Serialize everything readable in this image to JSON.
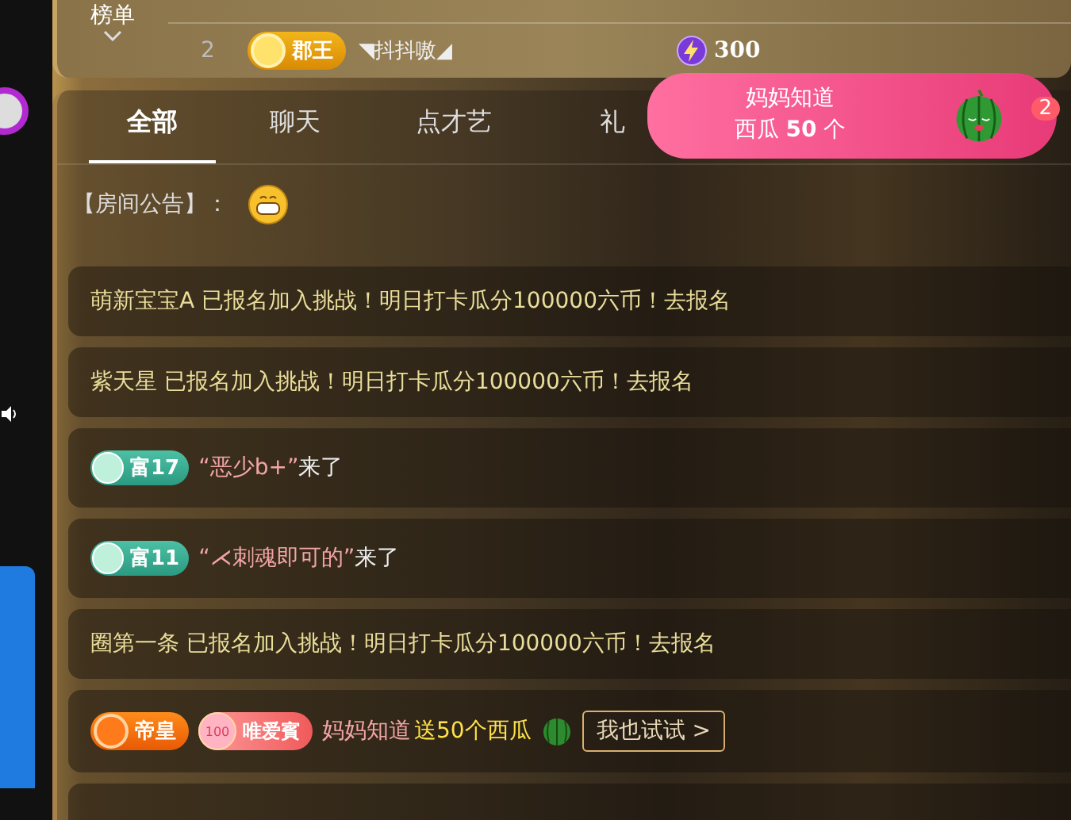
{
  "leaderboard": {
    "label": "榜单",
    "rows": [
      {
        "rank": "2",
        "badge": "郡王",
        "name": "◥抖抖嗷◢",
        "score": "300"
      }
    ]
  },
  "tabs": [
    {
      "label": "全部",
      "selected": true
    },
    {
      "label": "聊天",
      "selected": false
    },
    {
      "label": "点才艺",
      "selected": false
    },
    {
      "label": "礼",
      "selected": false
    }
  ],
  "gift_popup": {
    "sender": "妈妈知道",
    "gift": "西瓜 **50** 个",
    "count": "2"
  },
  "announcement": {
    "label": "【房间公告】："
  },
  "messages": [
    {
      "kind": "notice",
      "text": "萌新宝宝A 已报名加入挑战！明日打卡瓜分100000六币！去报名"
    },
    {
      "kind": "notice",
      "text": "紫天星 已报名加入挑战！明日打卡瓜分100000六币！去报名"
    },
    {
      "kind": "enter",
      "badge": "富17",
      "user": "“恶少b+”",
      "suffix": "来了"
    },
    {
      "kind": "enter",
      "badge": "富11",
      "user": "“⋌刺魂即可的”",
      "suffix": "来了"
    },
    {
      "kind": "notice",
      "text": "圈第一条 已报名加入挑战！明日打卡瓜分100000六币！去报名"
    },
    {
      "kind": "gift",
      "rank_badge": "帝皇",
      "fan_level": "100",
      "fan_badge": "唯爱賓",
      "user": "妈妈知道",
      "action": "送50个西瓜",
      "button": "我也试试 >"
    },
    {
      "kind": "empty"
    }
  ]
}
